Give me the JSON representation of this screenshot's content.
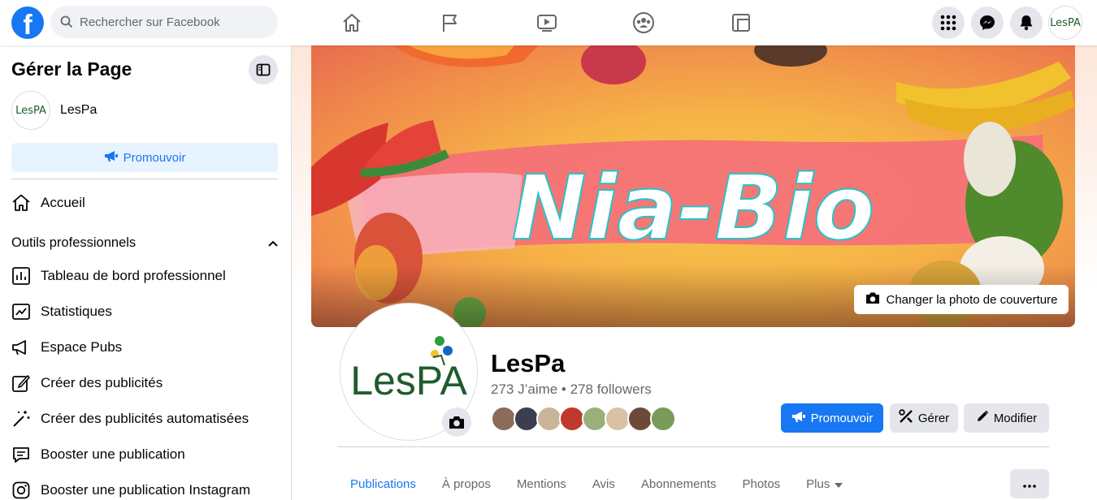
{
  "topbar": {
    "search_placeholder": "Rechercher sur Facebook",
    "nav_icons": [
      "home-icon",
      "pages-flag-icon",
      "watch-video-icon",
      "groups-icon",
      "gaming-icon"
    ],
    "right_icons": [
      "menu-grid-icon",
      "messenger-icon",
      "notifications-bell-icon"
    ],
    "avatar_text": "LesPA"
  },
  "sidebar": {
    "title": "Gérer la Page",
    "page_name": "LesPa",
    "page_avatar_text": "LesPA",
    "promote_label": "Promouvoir",
    "home_label": "Accueil",
    "section_title": "Outils professionnels",
    "items": [
      {
        "label": "Tableau de bord professionnel",
        "icon": "dashboard-icon"
      },
      {
        "label": "Statistiques",
        "icon": "statistics-icon"
      },
      {
        "label": "Espace Pubs",
        "icon": "megaphone-icon"
      },
      {
        "label": "Créer des publicités",
        "icon": "edit-pencil-icon"
      },
      {
        "label": "Créer des publicités automatisées",
        "icon": "magic-wand-icon"
      },
      {
        "label": "Booster une publication",
        "icon": "boost-post-icon"
      },
      {
        "label": "Booster une publication Instagram",
        "icon": "instagram-icon"
      }
    ]
  },
  "cover": {
    "text": "Nia-Bio",
    "change_cover_label": "Changer la photo de couverture"
  },
  "profile": {
    "logo_text": "LesPA",
    "name": "LesPa",
    "stats": "273 J’aime • 278 followers",
    "follower_colors": [
      "#8b6b5a",
      "#3d3d50",
      "#c9b59a",
      "#c0392b",
      "#9ab07a",
      "#d9c2a3",
      "#6b4a3a",
      "#7a9a5a"
    ]
  },
  "actions": {
    "promote": "Promouvoir",
    "manage": "Gérer",
    "edit": "Modifier"
  },
  "tabs": [
    "Publications",
    "À propos",
    "Mentions",
    "Avis",
    "Abonnements",
    "Photos",
    "Plus"
  ],
  "colors": {
    "brand": "#1877f2",
    "button_grey": "#e4e6eb",
    "logo_green": "#1f5c2e"
  }
}
